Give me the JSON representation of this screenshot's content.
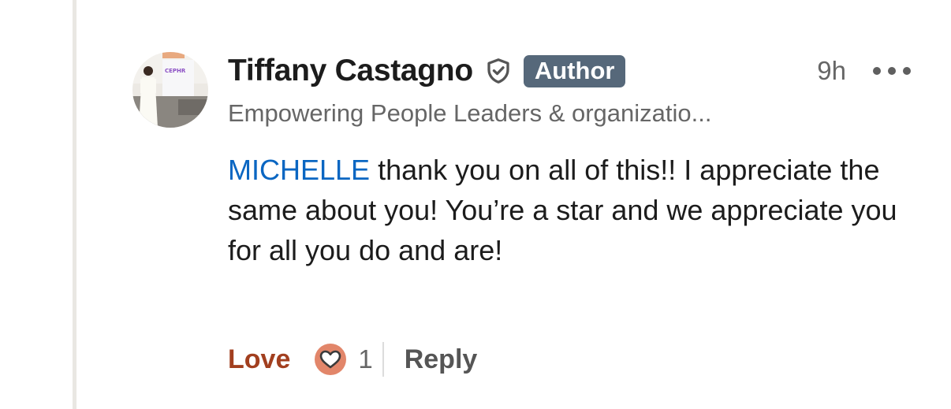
{
  "comment": {
    "author_name": "Tiffany Castagno",
    "author_badge": "Author",
    "time_ago": "9h",
    "headline": "Empowering People Leaders & organizatio...",
    "mention": "MICHELLE",
    "text": " thank you on all of this!! I appreciate the same about you! You’re a star and we appreciate you for all you do and are!",
    "avatar_sign_text": "CEPHR"
  },
  "actions": {
    "reaction_label": "Love",
    "reaction_count": "1",
    "reply_label": "Reply"
  },
  "icons": {
    "verified": "shield-check-icon",
    "more": "ellipsis-icon",
    "reaction": "heart-icon"
  },
  "colors": {
    "mention": "#0a66c2",
    "love": "#a23f1f",
    "badge_bg": "#56687a",
    "heart_bg": "#e2866a"
  }
}
